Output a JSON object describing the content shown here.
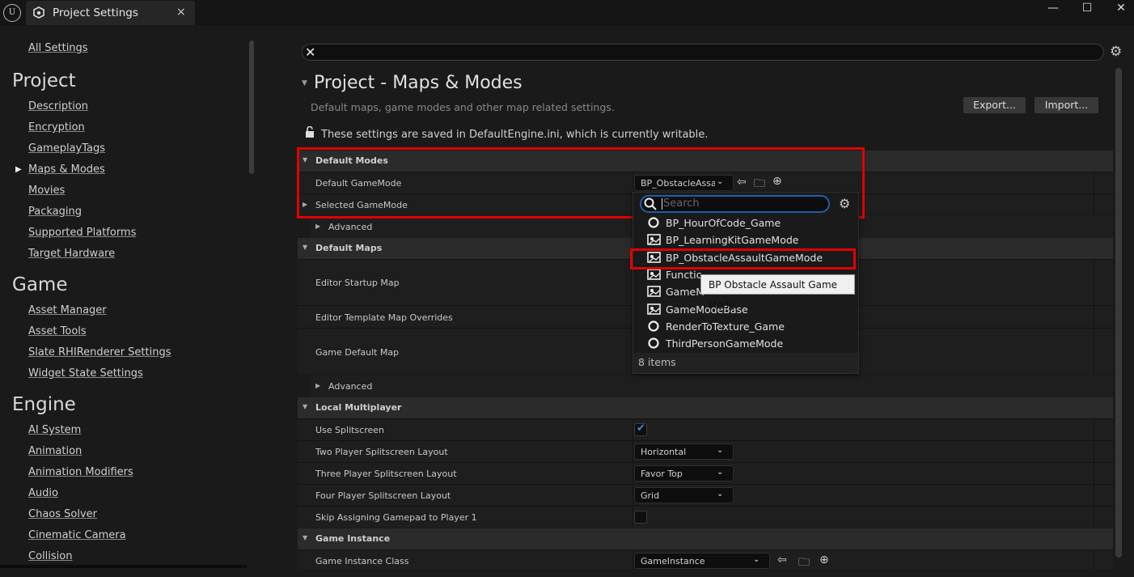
{
  "tab": {
    "title": "Project Settings",
    "close": "×"
  },
  "window": {
    "minimize": "—",
    "maximize": "☐",
    "close": "✕"
  },
  "sidebar": {
    "all_settings": "All Settings",
    "project": {
      "heading": "Project",
      "items": [
        "Description",
        "Encryption",
        "GameplayTags",
        "Maps & Modes",
        "Movies",
        "Packaging",
        "Supported Platforms",
        "Target Hardware"
      ],
      "selected_index": 3
    },
    "game": {
      "heading": "Game",
      "items": [
        "Asset Manager",
        "Asset Tools",
        "Slate RHIRenderer Settings",
        "Widget State Settings"
      ]
    },
    "engine": {
      "heading": "Engine",
      "items": [
        "AI System",
        "Animation",
        "Animation Modifiers",
        "Audio",
        "Chaos Solver",
        "Cinematic Camera",
        "Collision"
      ]
    }
  },
  "main": {
    "title": "Project - Maps & Modes",
    "description": "Default maps, game modes and other map related settings.",
    "export_label": "Export...",
    "import_label": "Import...",
    "lock_text": "These settings are saved in DefaultEngine.ini, which is currently writable.",
    "categories": {
      "default_modes": "Default Modes",
      "default_maps": "Default Maps",
      "local_multiplayer": "Local Multiplayer",
      "game_instance": "Game Instance"
    },
    "rows": {
      "default_gamemode": "Default GameMode",
      "default_gamemode_value": "BP_ObstacleAssau",
      "selected_gamemode": "Selected GameMode",
      "advanced": "Advanced",
      "editor_startup_map": "Editor Startup Map",
      "editor_template_map_overrides": "Editor Template Map Overrides",
      "game_default_map": "Game Default Map",
      "use_splitscreen": "Use Splitscreen",
      "two_player_layout": "Two Player Splitscreen Layout",
      "two_player_value": "Horizontal",
      "three_player_layout": "Three Player Splitscreen Layout",
      "three_player_value": "Favor Top",
      "four_player_layout": "Four Player Splitscreen Layout",
      "four_player_value": "Grid",
      "skip_gamepad": "Skip Assigning Gamepad to Player 1",
      "game_instance_class": "Game Instance Class",
      "game_instance_value": "GameInstance"
    }
  },
  "dropdown": {
    "search_placeholder": "Search",
    "items": [
      {
        "label": "BP_HourOfCode_Game",
        "icon": "circle-icon"
      },
      {
        "label": "BP_LearningKitGameMode",
        "icon": "blueprint-icon"
      },
      {
        "label": "BP_ObstacleAssaultGameMode",
        "icon": "blueprint-icon"
      },
      {
        "label": "Functic",
        "icon": "blueprint-icon"
      },
      {
        "label": "GameM",
        "icon": "blueprint-icon"
      },
      {
        "label": "GameModeBase",
        "icon": "blueprint-icon"
      },
      {
        "label": "RenderToTexture_Game",
        "icon": "circle-icon"
      },
      {
        "label": "ThirdPersonGameMode",
        "icon": "circle-icon"
      }
    ],
    "count": "8 items",
    "tooltip": "BP Obstacle Assault Game Mode"
  },
  "colors": {
    "highlight": "#e10000",
    "accent": "#3a8ee6"
  }
}
